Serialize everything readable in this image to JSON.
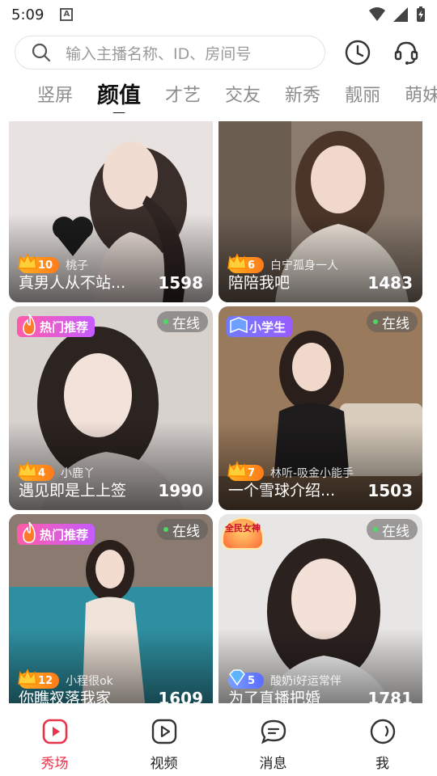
{
  "status": {
    "time": "5:09",
    "notif": "A"
  },
  "search": {
    "placeholder": "输入主播名称、ID、房间号"
  },
  "tabs": [
    {
      "label": "竖屏"
    },
    {
      "label": "颜值"
    },
    {
      "label": "才艺"
    },
    {
      "label": "交友"
    },
    {
      "label": "新秀"
    },
    {
      "label": "靓丽"
    },
    {
      "label": "萌妹"
    }
  ],
  "cards": [
    {
      "title": "真男人从不站...",
      "host": "桃子",
      "level": "10",
      "count": "1598",
      "online": "",
      "tag": ""
    },
    {
      "title": "陪陪我吧",
      "host": "白宁孤身一人",
      "level": "6",
      "count": "1483",
      "online": "",
      "tag": ""
    },
    {
      "title": "遇见即是上上签",
      "host": "小鹿丫",
      "level": "4",
      "count": "1990",
      "online": "在线",
      "tag": "热门推荐"
    },
    {
      "title": "一个雪球介绍...",
      "host": "林听-吸金小能手",
      "level": "7",
      "count": "1503",
      "online": "在线",
      "tag": "小学生"
    },
    {
      "title": "你瞧衩落我家",
      "host": "小程很ok",
      "level": "12",
      "count": "1609",
      "online": "在线",
      "tag": "热门推荐"
    },
    {
      "title": "为了直播把婚",
      "host": "酸奶i好运常伴",
      "level": "5",
      "count": "1781",
      "online": "在线",
      "tag": "全民女神"
    }
  ],
  "nav": [
    {
      "label": "秀场"
    },
    {
      "label": "视频"
    },
    {
      "label": "消息"
    },
    {
      "label": "我"
    }
  ],
  "colors": {
    "accent": "#e8344a",
    "hot_tag": "#ff5ca8",
    "student_tag": "#7a6cff",
    "online_dot": "#4cd964"
  }
}
